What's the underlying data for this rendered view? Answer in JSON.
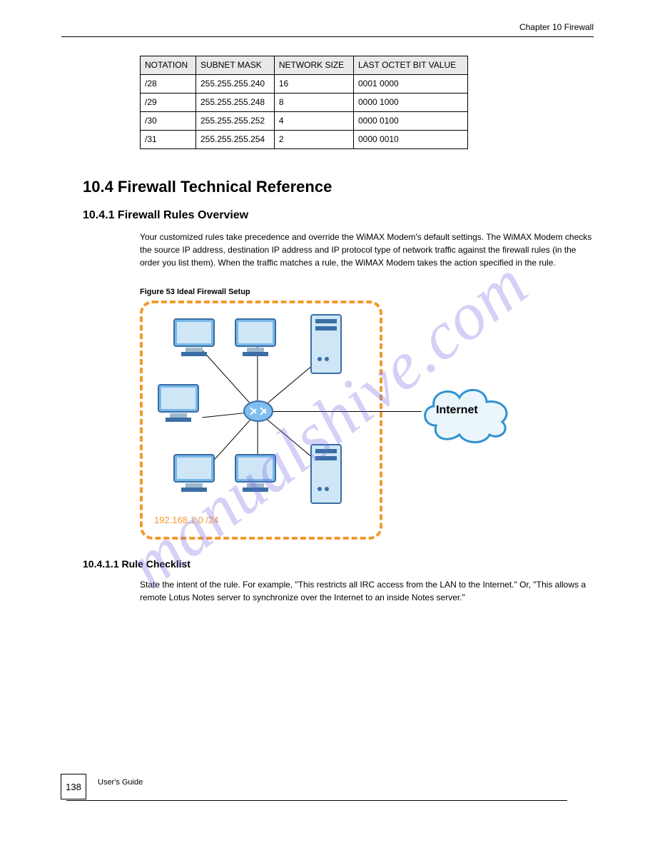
{
  "header": {
    "chapter_ref": "Chapter 10 Firewall"
  },
  "table": {
    "columns": [
      "NOTATION",
      "SUBNET MASK",
      "NETWORK SIZE",
      "LAST OCTET BIT VALUE"
    ],
    "rows": [
      [
        "/28",
        "255.255.255.240",
        "16",
        "0001 0000"
      ],
      [
        "/29",
        "255.255.255.248",
        "8",
        "0000 1000"
      ],
      [
        "/30",
        "255.255.255.252",
        "4",
        "0000 0100"
      ],
      [
        "/31",
        "255.255.255.254",
        "2",
        "0000 0010"
      ]
    ]
  },
  "headings": {
    "h1": "10.4  Firewall Technical Reference",
    "h2": "10.4.1  Firewall Rules Overview",
    "h2_para": "Your customized rules take precedence and override the WiMAX Modem's default settings. The WiMAX Modem checks the source IP address, destination IP address and IP protocol type of network traffic against the firewall rules (in the order you list them). When the traffic matches a rule, the WiMAX Modem takes the action specified in the rule.",
    "h3": "10.4.1.1  Rule Checklist",
    "h3_para": "State the intent of the rule. For example, \"This restricts all IRC access from the LAN to the Internet.\" Or, \"This allows a remote Lotus Notes server to synchronize over the Internet to an inside Notes server.\""
  },
  "figure": {
    "caption": "Figure 53   Ideal Firewall Setup",
    "cloud_label": "Internet",
    "network_label": "192.168.1.0 /24"
  },
  "watermark": "manualshive.com",
  "footer": {
    "page_number": "138",
    "guide_title": "User's Guide"
  }
}
